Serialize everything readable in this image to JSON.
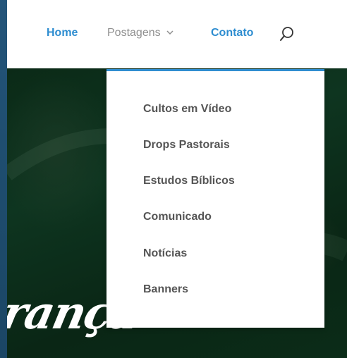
{
  "nav": {
    "home": "Home",
    "posts": "Postagens",
    "contact": "Contato",
    "search_icon": "search-icon",
    "chevron_icon": "chevron-down-icon"
  },
  "dropdown": {
    "items": [
      {
        "label": "Cultos em Vídeo"
      },
      {
        "label": "Drops Pastorais"
      },
      {
        "label": "Estudos Bíblicos"
      },
      {
        "label": "Comunicado"
      },
      {
        "label": "Notícias"
      },
      {
        "label": "Banners"
      }
    ]
  },
  "hero": {
    "script_text": "rança"
  },
  "colors": {
    "accent": "#2e8dd0",
    "nav_muted": "#8f8f8f",
    "menu_text": "#555555",
    "page_bg": "#1f4e70",
    "hero_bg": "#0e3520"
  }
}
